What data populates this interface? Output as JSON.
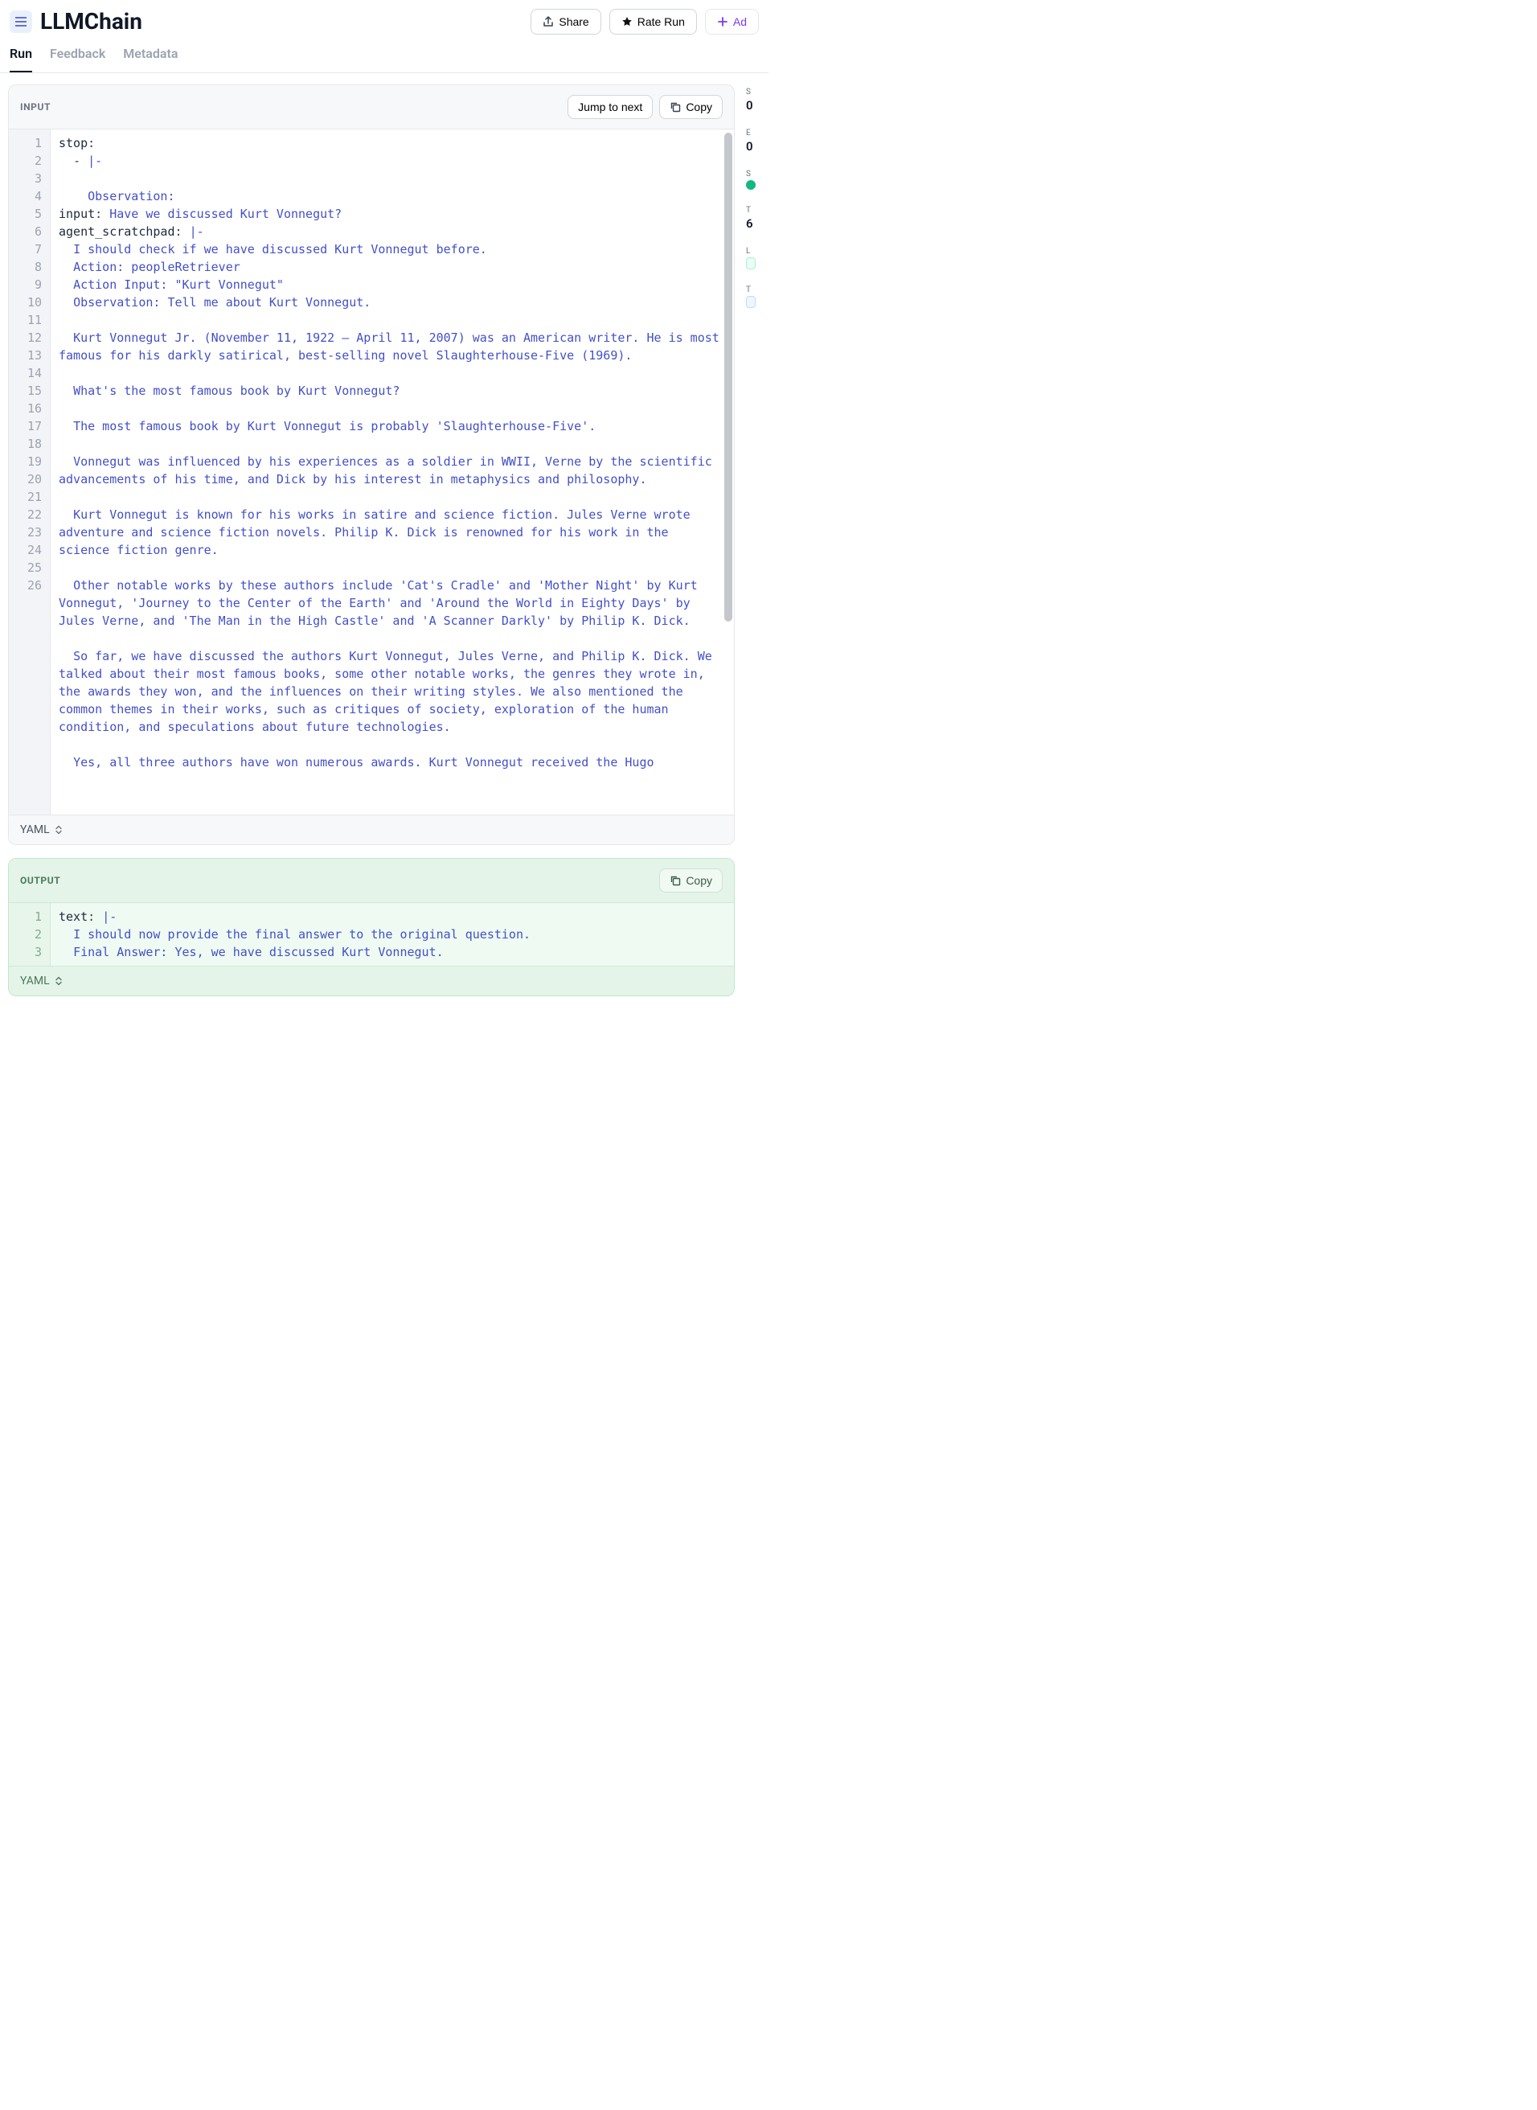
{
  "header": {
    "title": "LLMChain",
    "share_label": "Share",
    "rate_label": "Rate Run",
    "add_label": "Ad"
  },
  "tabs": {
    "run": "Run",
    "feedback": "Feedback",
    "metadata": "Metadata"
  },
  "input_panel": {
    "title": "INPUT",
    "jump_label": "Jump to next",
    "copy_label": "Copy",
    "format_label": "YAML",
    "lines": [
      {
        "n": 1,
        "segs": [
          {
            "t": "stop",
            "c": "k-key"
          },
          {
            "t": ":",
            "c": "k-punc"
          }
        ]
      },
      {
        "n": 2,
        "segs": [
          {
            "t": "  - ",
            "c": "k-punc"
          },
          {
            "t": "|-",
            "c": "k-val"
          }
        ]
      },
      {
        "n": 3,
        "segs": []
      },
      {
        "n": 4,
        "segs": [
          {
            "t": "    Observation:",
            "c": "k-val"
          }
        ]
      },
      {
        "n": 5,
        "segs": [
          {
            "t": "input",
            "c": "k-key"
          },
          {
            "t": ": ",
            "c": "k-punc"
          },
          {
            "t": "Have we discussed Kurt Vonnegut?",
            "c": "k-val"
          }
        ]
      },
      {
        "n": 6,
        "segs": [
          {
            "t": "agent_scratchpad",
            "c": "k-key"
          },
          {
            "t": ": ",
            "c": "k-punc"
          },
          {
            "t": "|-",
            "c": "k-val"
          }
        ]
      },
      {
        "n": 7,
        "segs": [
          {
            "t": "  I should check if we have discussed Kurt Vonnegut before.",
            "c": "k-val"
          }
        ]
      },
      {
        "n": 8,
        "segs": [
          {
            "t": "  Action: peopleRetriever",
            "c": "k-val"
          }
        ]
      },
      {
        "n": 9,
        "segs": [
          {
            "t": "  Action Input: \"Kurt Vonnegut\"",
            "c": "k-val"
          }
        ]
      },
      {
        "n": 10,
        "segs": [
          {
            "t": "  Observation: Tell me about Kurt Vonnegut.",
            "c": "k-val"
          }
        ]
      },
      {
        "n": 11,
        "segs": []
      },
      {
        "n": 12,
        "segs": [
          {
            "t": "  Kurt Vonnegut Jr. (November 11, 1922 – April 11, 2007) was an American writer. He is most famous for his darkly satirical, best-selling novel Slaughterhouse-Five (1969).",
            "c": "k-val"
          }
        ]
      },
      {
        "n": 13,
        "segs": []
      },
      {
        "n": 14,
        "segs": [
          {
            "t": "  What's the most famous book by Kurt Vonnegut?",
            "c": "k-val"
          }
        ]
      },
      {
        "n": 15,
        "segs": []
      },
      {
        "n": 16,
        "segs": [
          {
            "t": "  The most famous book by Kurt Vonnegut is probably 'Slaughterhouse-Five'.",
            "c": "k-val"
          }
        ]
      },
      {
        "n": 17,
        "segs": []
      },
      {
        "n": 18,
        "segs": [
          {
            "t": "  Vonnegut was influenced by his experiences as a soldier in WWII, Verne by the scientific advancements of his time, and Dick by his interest in metaphysics and philosophy.",
            "c": "k-val"
          }
        ]
      },
      {
        "n": 19,
        "segs": []
      },
      {
        "n": 20,
        "segs": [
          {
            "t": "  Kurt Vonnegut is known for his works in satire and science fiction. Jules Verne wrote adventure and science fiction novels. Philip K. Dick is renowned for his work in the science fiction genre.",
            "c": "k-val"
          }
        ]
      },
      {
        "n": 21,
        "segs": []
      },
      {
        "n": 22,
        "segs": [
          {
            "t": "  Other notable works by these authors include 'Cat's Cradle' and 'Mother Night' by Kurt Vonnegut, 'Journey to the Center of the Earth' and 'Around the World in Eighty Days' by Jules Verne, and 'The Man in the High Castle' and 'A Scanner Darkly' by Philip K. Dick.",
            "c": "k-val"
          }
        ]
      },
      {
        "n": 23,
        "segs": []
      },
      {
        "n": 24,
        "segs": [
          {
            "t": "  So far, we have discussed the authors Kurt Vonnegut, Jules Verne, and Philip K. Dick. We talked about their most famous books, some other notable works, the genres they wrote in, the awards they won, and the influences on their writing styles. We also mentioned the common themes in their works, such as critiques of society, exploration of the human condition, and speculations about future technologies.",
            "c": "k-val"
          }
        ]
      },
      {
        "n": 25,
        "segs": []
      },
      {
        "n": 26,
        "segs": [
          {
            "t": "  Yes, all three authors have won numerous awards. Kurt Vonnegut received the Hugo",
            "c": "k-val"
          }
        ]
      }
    ]
  },
  "output_panel": {
    "title": "OUTPUT",
    "copy_label": "Copy",
    "format_label": "YAML",
    "lines": [
      {
        "n": 1,
        "segs": [
          {
            "t": "text",
            "c": "k-key"
          },
          {
            "t": ": ",
            "c": "k-punc"
          },
          {
            "t": "|-",
            "c": "k-val"
          }
        ]
      },
      {
        "n": 2,
        "segs": [
          {
            "t": "  I should now provide the final answer to the original question.",
            "c": "k-val"
          }
        ]
      },
      {
        "n": 3,
        "segs": [
          {
            "t": "  Final Answer: Yes, we have discussed Kurt Vonnegut.",
            "c": "k-val"
          }
        ]
      }
    ]
  },
  "sidebar": {
    "items": [
      {
        "label": "S",
        "val": "0"
      },
      {
        "label": "E",
        "val": "0"
      },
      {
        "label": "S",
        "val": ""
      },
      {
        "label": "T",
        "val": "6"
      },
      {
        "label": "L",
        "val": ""
      },
      {
        "label": "T",
        "val": ""
      }
    ]
  }
}
